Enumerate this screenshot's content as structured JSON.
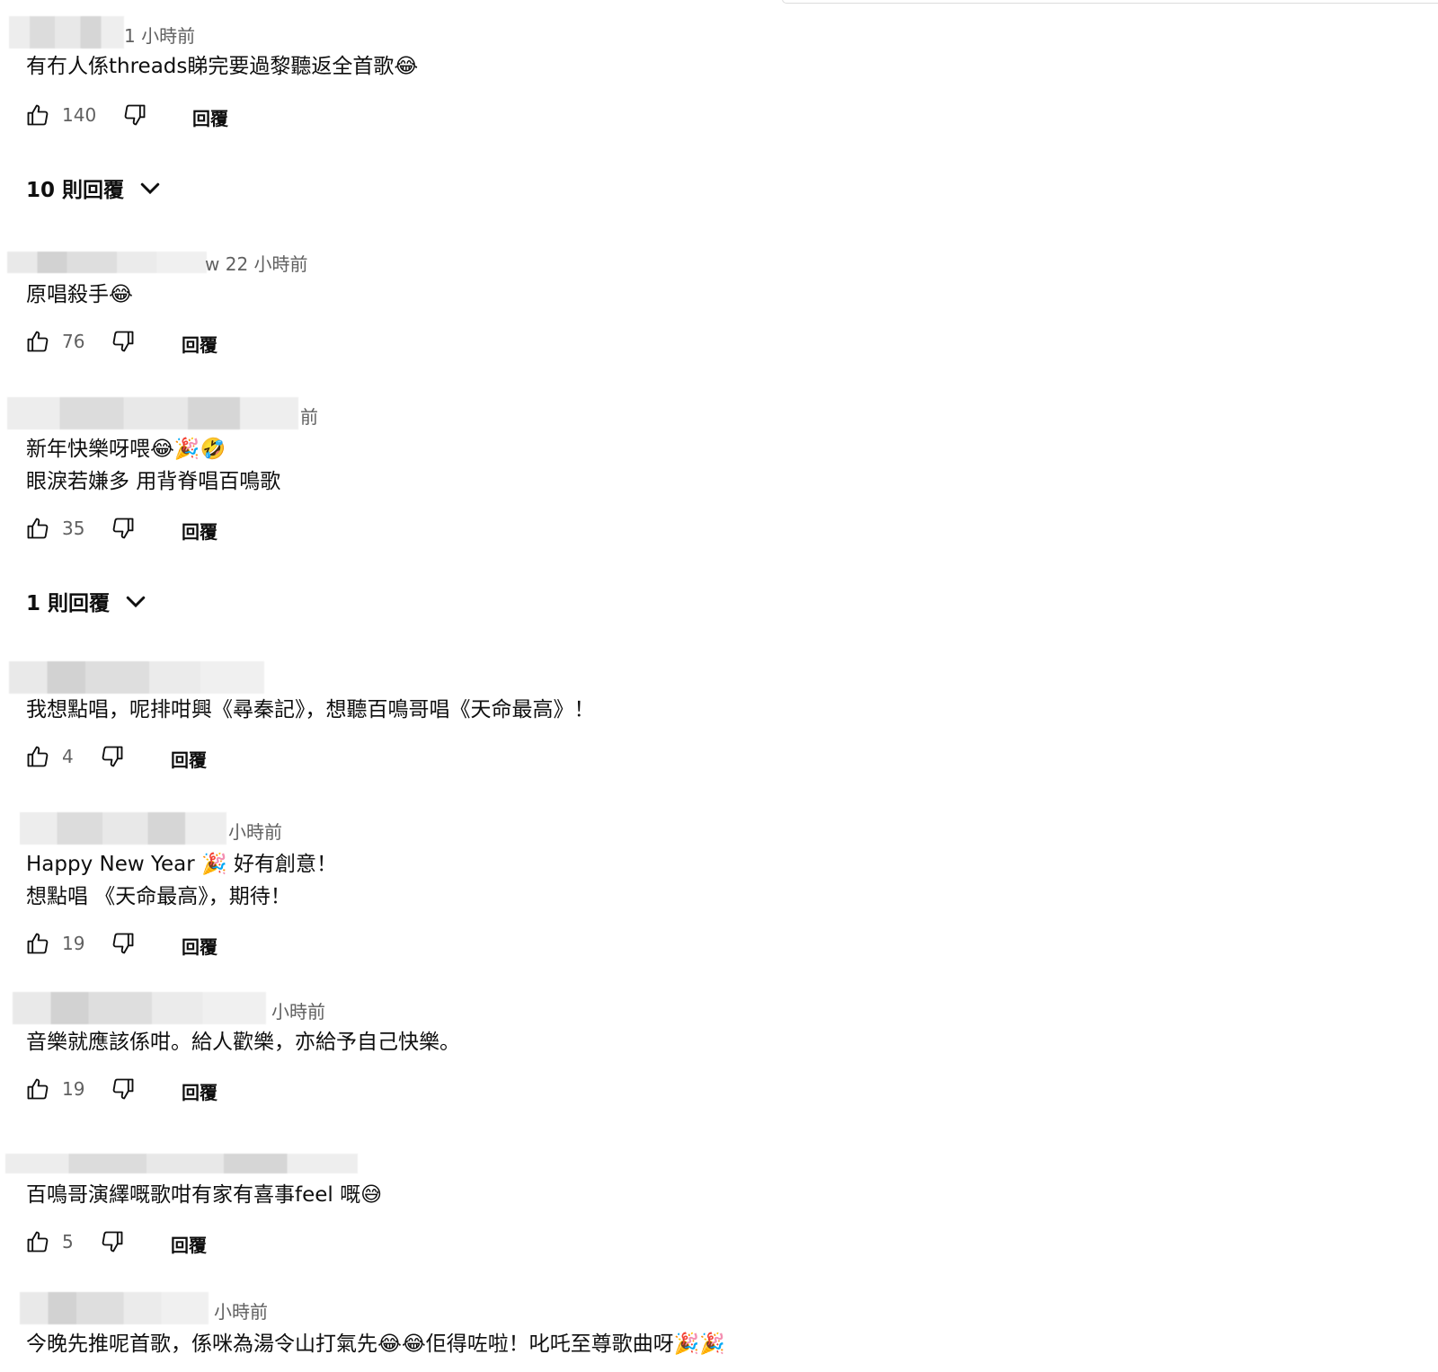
{
  "comments": [
    {
      "time": "1 小時前",
      "text": "有冇人係threads睇完要過黎聽返全首歌😂",
      "likes": "140",
      "reply": "回覆"
    },
    {
      "time": "w 22 小時前",
      "text": "原唱殺手😂",
      "likes": "76",
      "reply": "回覆"
    },
    {
      "time": "前",
      "line1": "新年快樂呀喂😂🎉🤣",
      "line2": "眼淚若嫌多 用背脊唱百鳴歌",
      "likes": "35",
      "reply": "回覆"
    },
    {
      "time": "",
      "text": "我想點唱，呢排咁興《尋秦記》，想聽百鳴哥唱《天命最高》！",
      "likes": "4",
      "reply": "回覆"
    },
    {
      "time": "小時前",
      "line1": "Happy New Year 🎉 好有創意！",
      "line2": "想點唱 《天命最高》，期待！",
      "likes": "19",
      "reply": "回覆"
    },
    {
      "time": "小時前",
      "text": "音樂就應該係咁。給人歡樂，亦給予自己快樂。",
      "likes": "19",
      "reply": "回覆"
    },
    {
      "time": "",
      "text": "百鳴哥演繹嘅歌咁有家有喜事feel 嘅😅",
      "likes": "5",
      "reply": "回覆"
    },
    {
      "time": "小時前",
      "text": "今晚先推呢首歌，係咪為湯令山打氣先😂😂佢得咗啦！叱吒至尊歌曲呀🎉🎉"
    }
  ],
  "reply_threads": [
    {
      "label": "10 則回覆"
    },
    {
      "label": "1 則回覆"
    }
  ],
  "icons": {
    "like": "thumbs-up-icon",
    "dislike": "thumbs-down-icon",
    "expand": "chevron-down-icon"
  }
}
